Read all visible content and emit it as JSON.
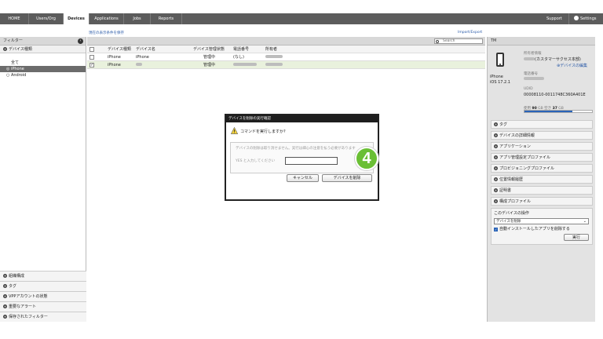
{
  "nav": {
    "tabs": [
      {
        "label": "HOME",
        "active": false
      },
      {
        "label": "Users/Org",
        "active": false
      },
      {
        "label": "Devices",
        "active": true
      },
      {
        "label": "Applications",
        "active": false
      },
      {
        "label": "Jobs",
        "active": false
      },
      {
        "label": "Reports",
        "active": false
      }
    ],
    "support": "Support",
    "settings": "Settings"
  },
  "subheader": {
    "save_filter": "現在の表示条件を保存",
    "import_export": "Import/Export"
  },
  "filter": {
    "title": "フィルター",
    "device_type_section": "デバイス種類",
    "items": [
      "全て",
      "iPhone",
      "Android"
    ],
    "selected": "iPhone",
    "bottom_sections": [
      "組織構成",
      "タグ",
      "VPPアカウントの状態",
      "重要なアラート",
      "保存されたフィルター"
    ]
  },
  "table": {
    "search_placeholder": "Search",
    "headers": [
      "デバイス種類",
      "デバイス名",
      "デバイス管理状態",
      "電話番号",
      "所有者"
    ],
    "rows": [
      {
        "type": "iPhone",
        "name": "iPhone",
        "status": "管理中",
        "phone": "(なし)",
        "checked": false
      },
      {
        "type": "iPhone",
        "name": "",
        "status": "管理中",
        "phone": "",
        "checked": true
      }
    ]
  },
  "modal": {
    "title": "デバイスを削除の実行確認",
    "question": "コマンドを実行しますか?",
    "message": "デバイスの削除は取り消せません。実行は細心の注意を払う必要があります",
    "input_label": "YES と入力してください",
    "cancel": "キャンセル",
    "confirm": "デバイスを削除",
    "step_number": "4"
  },
  "device_panel": {
    "header": "TM",
    "owner_label": "所有者情報",
    "owner_org": "(カスタマーサクセス本部)",
    "edit_link": "デバイスの編集",
    "phone_label": "電話番号",
    "model": "iPhone",
    "os": "iOS 17.2.1",
    "udid_label": "UDID",
    "udid": "00008110-0011748C360A401E",
    "storage_used_label": "使用",
    "storage_used": "90",
    "storage_free_label": "空き",
    "storage_free": "37",
    "storage_unit": "GB",
    "storage_used_fraction": 0.71,
    "sections": [
      "タグ",
      "デバイスの詳細情報",
      "アプリケーション",
      "アプリ管理設定プロファイル",
      "プロビジョニングプロファイル",
      "位置情報履歴",
      "証明書",
      "構成プロファイル"
    ],
    "ops_title": "このデバイスの操作",
    "ops_selected": "デバイスを削除",
    "ops_checkbox": "自動インストールしたアプリを削除する",
    "ops_run": "実行"
  }
}
